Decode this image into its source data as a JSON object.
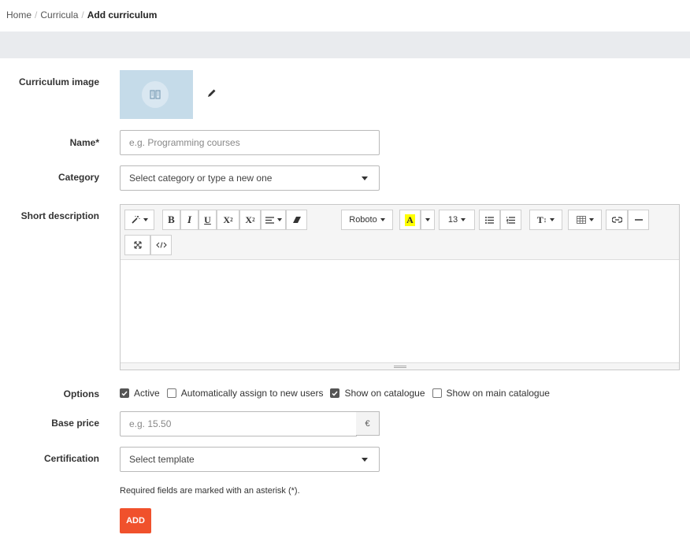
{
  "breadcrumb": {
    "home": "Home",
    "sep": "/",
    "curricula": "Curricula",
    "current": "Add curriculum"
  },
  "form": {
    "image_label": "Curriculum image",
    "name_label": "Name*",
    "name_placeholder": "e.g. Programming courses",
    "category_label": "Category",
    "category_value": "Select category or type a new one",
    "description_label": "Short description",
    "options_label": "Options",
    "options": [
      {
        "label": "Active",
        "checked": true
      },
      {
        "label": "Automatically assign to new users",
        "checked": false
      },
      {
        "label": "Show on catalogue",
        "checked": true
      },
      {
        "label": "Show on main catalogue",
        "checked": false
      }
    ],
    "price_label": "Base price",
    "price_placeholder": "e.g. 15.50",
    "currency": "€",
    "certification_label": "Certification",
    "certification_value": "Select template",
    "hint": "Required fields are marked with an asterisk (*).",
    "add_button": "ADD"
  },
  "toolbar": {
    "bold": "B",
    "italic": "I",
    "underline": "U",
    "superscript": "X",
    "subscript": "X",
    "font_name": "Roboto",
    "highlight": "A",
    "font_size": "13",
    "text_size": "T"
  },
  "colors": {
    "accent": "#f0512c",
    "band": "#e9ebee",
    "image_bg": "#c5dbe9"
  }
}
